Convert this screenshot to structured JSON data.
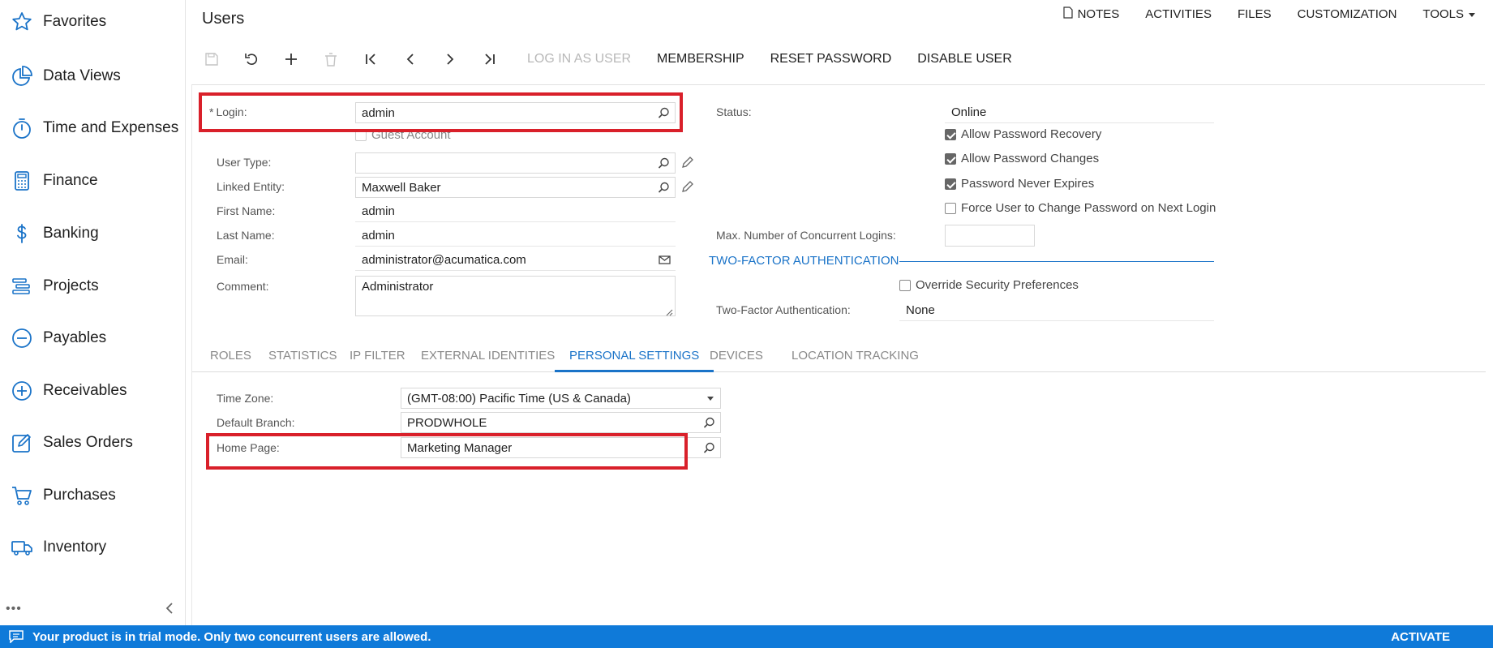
{
  "colors": {
    "accent": "#1a73c8",
    "highlight": "#d9202a",
    "trial_bar": "#0f7ad9"
  },
  "sidebar": {
    "items": [
      {
        "label": "Favorites",
        "icon": "star-icon"
      },
      {
        "label": "Data Views",
        "icon": "pie-chart-icon"
      },
      {
        "label": "Time and Expenses",
        "icon": "stopwatch-icon"
      },
      {
        "label": "Finance",
        "icon": "calculator-icon"
      },
      {
        "label": "Banking",
        "icon": "dollar-icon"
      },
      {
        "label": "Projects",
        "icon": "gantt-icon"
      },
      {
        "label": "Payables",
        "icon": "minus-circle-icon"
      },
      {
        "label": "Receivables",
        "icon": "plus-circle-icon"
      },
      {
        "label": "Sales Orders",
        "icon": "edit-icon"
      },
      {
        "label": "Purchases",
        "icon": "cart-icon"
      },
      {
        "label": "Inventory",
        "icon": "truck-icon"
      }
    ],
    "more_label": "•••"
  },
  "header": {
    "title": "Users",
    "links": {
      "notes": "NOTES",
      "activities": "ACTIVITIES",
      "files": "FILES",
      "customization": "CUSTOMIZATION",
      "tools": "TOOLS"
    }
  },
  "toolbar": {
    "login_as_user": "LOG IN AS USER",
    "membership": "MEMBERSHIP",
    "reset_password": "RESET PASSWORD",
    "disable_user": "DISABLE USER"
  },
  "form": {
    "login_label": "Login:",
    "login_required": "*",
    "login_value": "admin",
    "guest_account_label": "Guest Account",
    "guest_account_checked": false,
    "user_type_label": "User Type:",
    "user_type_value": "",
    "linked_entity_label": "Linked Entity:",
    "linked_entity_value": "Maxwell Baker",
    "first_name_label": "First Name:",
    "first_name_value": "admin",
    "last_name_label": "Last Name:",
    "last_name_value": "admin",
    "email_label": "Email:",
    "email_value": "administrator@acumatica.com",
    "comment_label": "Comment:",
    "comment_value": "Administrator",
    "status_label": "Status:",
    "status_value": "Online",
    "allow_recovery_label": "Allow Password Recovery",
    "allow_recovery_checked": true,
    "allow_changes_label": "Allow Password Changes",
    "allow_changes_checked": true,
    "never_expires_label": "Password Never Expires",
    "never_expires_checked": true,
    "force_change_label": "Force User to Change Password on Next Login",
    "force_change_checked": false,
    "max_logins_label": "Max. Number of Concurrent Logins:",
    "max_logins_value": "",
    "tfa_header": "TWO-FACTOR AUTHENTICATION",
    "override_security_label": "Override Security Preferences",
    "override_security_checked": false,
    "tfa_label": "Two-Factor Authentication:",
    "tfa_value": "None"
  },
  "tabs": [
    {
      "label": "ROLES",
      "active": false
    },
    {
      "label": "STATISTICS",
      "active": false
    },
    {
      "label": "IP FILTER",
      "active": false
    },
    {
      "label": "EXTERNAL IDENTITIES",
      "active": false
    },
    {
      "label": "PERSONAL SETTINGS",
      "active": true
    },
    {
      "label": "DEVICES",
      "active": false
    },
    {
      "label": "LOCATION TRACKING",
      "active": false
    }
  ],
  "personal": {
    "time_zone_label": "Time Zone:",
    "time_zone_value": "(GMT-08:00) Pacific Time (US & Canada)",
    "default_branch_label": "Default Branch:",
    "default_branch_value": "PRODWHOLE",
    "home_page_label": "Home Page:",
    "home_page_value": "Marketing Manager"
  },
  "trial_bar": {
    "message": "Your product is in trial mode. Only two concurrent users are allowed.",
    "activate": "ACTIVATE"
  }
}
